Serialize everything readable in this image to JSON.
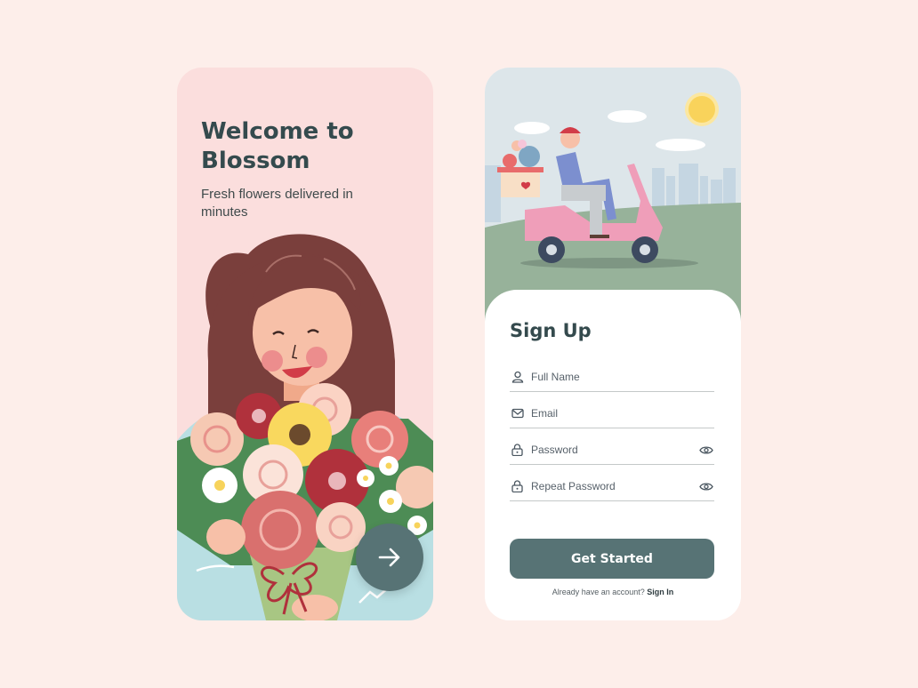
{
  "welcome": {
    "title": "Welcome to Blossom",
    "subtitle": "Fresh flowers delivered in minutes",
    "next_button_icon": "arrow-right-icon"
  },
  "signup": {
    "title": "Sign Up",
    "fields": [
      {
        "placeholder": "Full Name",
        "icon": "user-icon"
      },
      {
        "placeholder": "Email",
        "icon": "mail-icon"
      },
      {
        "placeholder": "Password",
        "icon": "lock-icon",
        "toggle_icon": "eye-icon"
      },
      {
        "placeholder": "Repeat Password",
        "icon": "lock-icon",
        "toggle_icon": "eye-icon"
      }
    ],
    "cta_label": "Get Started",
    "footer_text": "Already have an account?",
    "footer_link": "Sign In"
  },
  "colors": {
    "background": "#fdeeea",
    "welcome_card": "#fbdedd",
    "accent": "#577375",
    "title": "#344a4d",
    "field_line": "#c4c9c9"
  }
}
